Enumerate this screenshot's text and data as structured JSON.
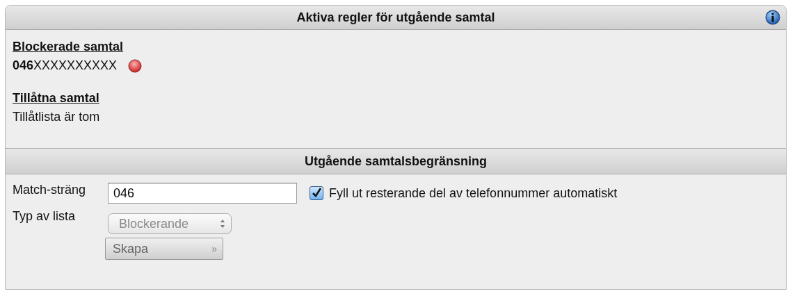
{
  "active_rules": {
    "title": "Aktiva regler för utgående samtal",
    "sections": [
      {
        "heading": "Blockerade samtal",
        "entries": [
          {
            "kind": "number",
            "text": "**046**XXXXXXXXXX"
          }
        ]
      },
      {
        "heading": "Tillåtna samtal",
        "entries": [
          {
            "kind": "note",
            "text": "Tillåtlista är tom"
          }
        ]
      }
    ]
  },
  "restriction": {
    "title": "Utgående samtalsbegränsning",
    "match_label": "Match-sträng",
    "match_value": "046",
    "autofill": {
      "label": "Fyll ut resterande del av telefonnummer automatiskt",
      "checked": true
    },
    "type_label": "Typ av lista",
    "type_value": "Blockerande",
    "type_disabled": true,
    "create_button": "Skapa",
    "create_arrow": "»",
    "create_disabled": true
  }
}
